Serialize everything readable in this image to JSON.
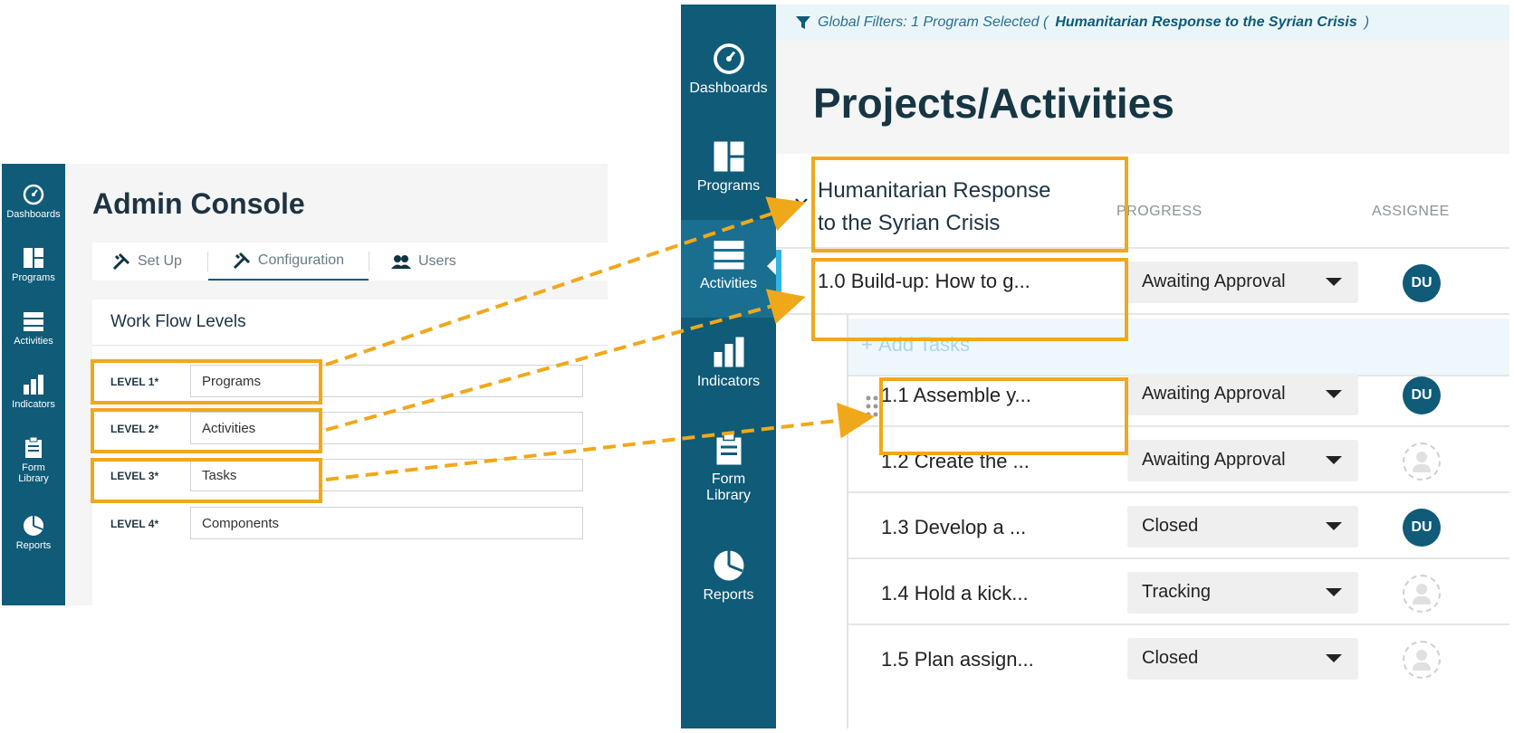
{
  "admin": {
    "title": "Admin Console",
    "sidebar": [
      {
        "label_1": "Dashboards",
        "label_2": "",
        "icon": "gauge-icon"
      },
      {
        "label_1": "Programs",
        "label_2": "",
        "icon": "programs-icon"
      },
      {
        "label_1": "Activities",
        "label_2": "",
        "icon": "server-icon"
      },
      {
        "label_1": "Indicators",
        "label_2": "",
        "icon": "bar-chart-icon"
      },
      {
        "label_1": "Form",
        "label_2": "Library",
        "icon": "clipboard-icon"
      },
      {
        "label_1": "Reports",
        "label_2": "",
        "icon": "pie-chart-icon"
      }
    ],
    "tabs": [
      {
        "label": "Set Up",
        "icon": "tools-icon"
      },
      {
        "label": "Configuration",
        "icon": "tools-icon"
      },
      {
        "label": "Users",
        "icon": "users-icon"
      }
    ],
    "panel_title": "Work Flow Levels",
    "levels": [
      {
        "label": "LEVEL 1*",
        "value": "Programs"
      },
      {
        "label": "LEVEL 2*",
        "value": "Activities"
      },
      {
        "label": "LEVEL 3*",
        "value": "Tasks"
      },
      {
        "label": "LEVEL 4*",
        "value": "Components"
      }
    ]
  },
  "app": {
    "filter_prefix": "Global Filters: 1 Program Selected (",
    "filter_program": "Humanitarian Response to the Syrian Crisis",
    "filter_suffix": ")",
    "page_title": "Projects/Activities",
    "sidebar": [
      {
        "label_1": "Dashboards",
        "label_2": ""
      },
      {
        "label_1": "Programs",
        "label_2": ""
      },
      {
        "label_1": "Activities",
        "label_2": ""
      },
      {
        "label_1": "Indicators",
        "label_2": ""
      },
      {
        "label_1": "Form",
        "label_2": "Library"
      },
      {
        "label_1": "Reports",
        "label_2": ""
      }
    ],
    "program_title_line1": "Humanitarian Response",
    "program_title_line2": "to the Syrian Crisis",
    "col_progress": "PROGRESS",
    "col_assignee": "ASSIGNEE",
    "add_tasks": "Add Tasks",
    "activity": {
      "name": "1.0 Build-up: How to g...",
      "status": "Awaiting Approval",
      "assignee": "DU"
    },
    "tasks": [
      {
        "name": "1.1 Assemble y...",
        "status": "Awaiting Approval",
        "assignee": "DU"
      },
      {
        "name": "1.2 Create the ...",
        "status": "Awaiting Approval",
        "assignee": ""
      },
      {
        "name": "1.3 Develop a ...",
        "status": "Closed",
        "assignee": "DU"
      },
      {
        "name": "1.4 Hold a kick...",
        "status": "Tracking",
        "assignee": ""
      },
      {
        "name": "1.5 Plan assign...",
        "status": "Closed",
        "assignee": ""
      }
    ],
    "colors": {
      "sidebar": "#0f5b78",
      "highlight": "#f0a81b",
      "accent": "#32b3e6"
    }
  }
}
